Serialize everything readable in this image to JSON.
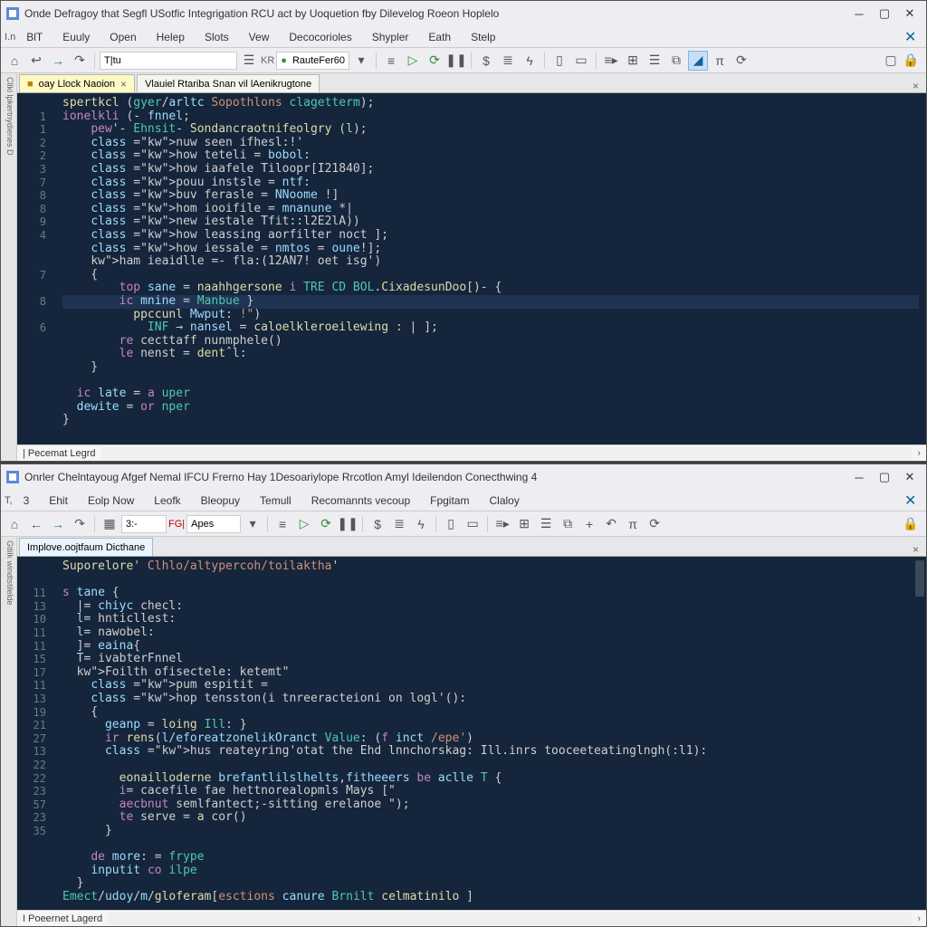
{
  "top_window": {
    "title": "Onde Defragoy that Segfl USotfic Integrigation RCU act by Uoquetion fby Dilevelog Roeon Hoplelo",
    "menu": [
      "BlT",
      "Euuly",
      "Open",
      "Helep",
      "Slots",
      "Vew",
      "Decocorioles",
      "Shypler",
      "Eath",
      "Stelp"
    ],
    "toolbar_label": "RauteFer60",
    "tabs": [
      {
        "label": "oay Llock Naoion",
        "active": true
      },
      {
        "label": "Vlauiel Rtariba Snan vil lAenikrugtone",
        "active": false
      }
    ],
    "gutter": [
      "",
      "1",
      "1",
      "2",
      "2",
      "3",
      "7",
      "8",
      "8",
      "9",
      "4",
      "",
      "",
      "7",
      "",
      "8",
      "",
      "6",
      "",
      "",
      "",
      "",
      "",
      "",
      "",
      ""
    ],
    "code_lines": [
      {
        "t": "spertkcl (gyer/arltc Sopothlons clagetterm);",
        "cls": "sig"
      },
      {
        "t": "ionelkli (- fnnel;",
        "cls": "kw1"
      },
      {
        "t": "    pew'- Ehnsit- Sondancraotnifeolgry (l);",
        "cls": "mix"
      },
      {
        "t": "    nuw seen ifhesl:!'",
        "cls": "kw2"
      },
      {
        "t": "    how teteli = bobol:",
        "cls": "kw2"
      },
      {
        "t": "    how iaafele Tiloopr[I21840];",
        "cls": "kw2"
      },
      {
        "t": "    pouu instsle = ntf:",
        "cls": "kw2"
      },
      {
        "t": "    buv ferasle = NNoome !]",
        "cls": "kw2"
      },
      {
        "t": "    hom iooifile = mnanune *|",
        "cls": "kw2"
      },
      {
        "t": "    new iestale Tfit::l2E2lA))",
        "cls": "kw2"
      },
      {
        "t": "    how leassing aorfilter noct ];",
        "cls": "kw2"
      },
      {
        "t": "    how iessale = nmtos = oune!];",
        "cls": "kw2"
      },
      {
        "t": "    ham ieaidlle =- fla:(12AN7! oet isg')",
        "cls": "kw2str"
      },
      {
        "t": "    {",
        "cls": "brace"
      },
      {
        "t": "        top sane = naahhgersone i TRE CD BOL.CixadesunDoo[)- {",
        "cls": "inner"
      },
      {
        "t": "        ic mnine = Manbue }",
        "cls": "innerhl"
      },
      {
        "t": "          ppccunl Mwput: !\")",
        "cls": "str2"
      },
      {
        "t": "            INF → nansel = caloelkleroeilewing : | ];",
        "cls": "deep"
      },
      {
        "t": "        re cecttaff nunmphele()",
        "cls": "kw3"
      },
      {
        "t": "        le nenst = dentˆl:",
        "cls": "kw3"
      },
      {
        "t": "    }",
        "cls": "brace"
      },
      {
        "t": "",
        "cls": ""
      },
      {
        "t": "  ic late = a uper",
        "cls": "end1"
      },
      {
        "t": "  dewite = or nper",
        "cls": "end2"
      },
      {
        "t": "}",
        "cls": "brace"
      }
    ],
    "status": "| Pecemat Legrd"
  },
  "bottom_window": {
    "title": "Onrler Chelntayoug Afgef Nemal IFCU Frerno Hay 1Desoariylope Rrcotlon Amyl Ideilendon Conecthwing 4",
    "menu": [
      "3",
      "Ehit",
      "Eolp Now",
      "Leofk",
      "Bleopuy",
      "Temull",
      "Recomannts vecoup",
      "Fpgitam",
      "Claloy"
    ],
    "toolbar_label": "Apes",
    "tabs": [
      {
        "label": "Implove.oojtfaum Dicthane",
        "active": true
      }
    ],
    "gutter": [
      "",
      "",
      "11",
      "13",
      "10",
      "11",
      "11",
      "15",
      "17",
      "11",
      "13",
      "19",
      "21",
      "27",
      "13",
      "22",
      "22",
      "23",
      "57",
      "23",
      "35",
      "",
      "",
      "",
      ""
    ],
    "code_lines": [
      {
        "t": "Suporelore' Clhlo/altypercoh/toilaktha'",
        "cls": "sig2"
      },
      {
        "t": "",
        "cls": ""
      },
      {
        "t": "s tane {",
        "cls": "kw4"
      },
      {
        "t": "  |= chiyc checl:",
        "cls": "stmt"
      },
      {
        "t": "  l= hnticllest:",
        "cls": "stmt"
      },
      {
        "t": "  l= nawobel:",
        "cls": "stmt"
      },
      {
        "t": "  ]= eaina{",
        "cls": "stmt"
      },
      {
        "t": "  T= ivabterFnnel",
        "cls": "stmt2"
      },
      {
        "t": "  Foilth ofisectele: ketemt\"",
        "cls": "kw2str"
      },
      {
        "t": "    pum espitit =",
        "cls": "kw2"
      },
      {
        "t": "    hop tensston(i tnreeracteioni on logl'():",
        "cls": "kw2"
      },
      {
        "t": "    {",
        "cls": "brace"
      },
      {
        "t": "      geanp = loing Ill: }",
        "cls": "inner2"
      },
      {
        "t": "      ir rens(l/eforeatzonelikOranct Value: (f inct /epe')",
        "cls": "inner3"
      },
      {
        "t": "      hus reateyring'otat the Ehd lnnchorskag: Ill.inrs tooceeteatinglngh(:l1):",
        "cls": "kw2"
      },
      {
        "t": "",
        "cls": ""
      },
      {
        "t": "        eonailloderne brefantlilslhelts,fitheeers be aclle T {",
        "cls": "deep2"
      },
      {
        "t": "        i= cacefile fae hettnorealopmls Mays [\"",
        "cls": "deep3"
      },
      {
        "t": "        aecbnut semlfantect;-sitting erelanoe \");",
        "cls": "deep3"
      },
      {
        "t": "        te serve = a cor()",
        "cls": "kw3"
      },
      {
        "t": "      }",
        "cls": "brace"
      },
      {
        "t": "",
        "cls": ""
      },
      {
        "t": "    de more: = frype",
        "cls": "end3"
      },
      {
        "t": "    inputit co ilpe",
        "cls": "end4"
      },
      {
        "t": "  }",
        "cls": "brace"
      },
      {
        "t": "Emect/udoy/m/gloferam[esctions canure Brnilt celmatinilo ]",
        "cls": "footer"
      }
    ],
    "status": "I Poeernet Lagerd"
  },
  "sidebars": {
    "top": "Cllki lpkertnydienes D",
    "bottom": "Gtlilk windtstilelde"
  }
}
